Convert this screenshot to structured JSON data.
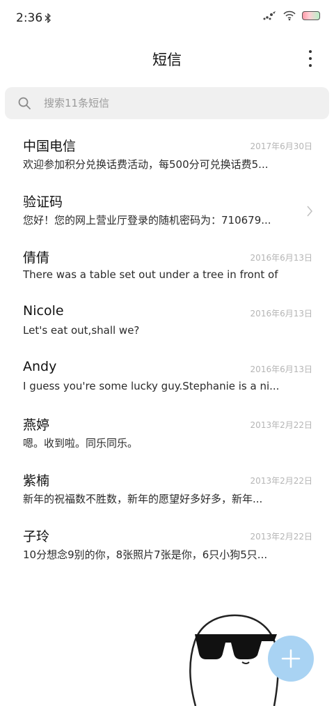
{
  "status_bar": {
    "time": "2:36",
    "icons": [
      "bluetooth-icon",
      "signal-icon",
      "wifi-icon",
      "battery-icon"
    ]
  },
  "header": {
    "title": "短信",
    "more_icon": "more-vertical-icon"
  },
  "search": {
    "placeholder": "搜索11条短信",
    "icon": "search-icon"
  },
  "messages": [
    {
      "name": "中国电信",
      "date": "2017年6月30日",
      "preview": "欢迎参加积分兑换话费活动，每500分可兑换话费5..."
    },
    {
      "name": "验证码",
      "date": "",
      "preview": "您好！您的网上营业厅登录的随机密码为：710679..."
    },
    {
      "name": "倩倩",
      "date": "2016年6月13日",
      "preview": "There was a table set out under a tree in front of ..."
    },
    {
      "name": "Nicole",
      "date": "2016年6月13日",
      "preview": "Let's eat out,shall we?"
    },
    {
      "name": "Andy",
      "date": "2016年6月13日",
      "preview": "I guess you're some lucky guy.Stephanie is a ni..."
    },
    {
      "name": "燕婷",
      "date": "2013年2月22日",
      "preview": "嗯。收到啦。同乐同乐。"
    },
    {
      "name": "紫楠",
      "date": "2013年2月22日",
      "preview": "新年的祝福数不胜数，新年的愿望好多好多，新年..."
    },
    {
      "name": "子玲",
      "date": "2013年2月22日",
      "preview": "10分想念9别的你，8张照片7张是你，6只小狗5只..."
    }
  ],
  "fab": {
    "icon": "plus-icon",
    "color": "#a9d3f3"
  },
  "colors": {
    "background": "#ffffff",
    "search_bg": "#f0f0f0",
    "date_text": "#b5b5b5"
  }
}
